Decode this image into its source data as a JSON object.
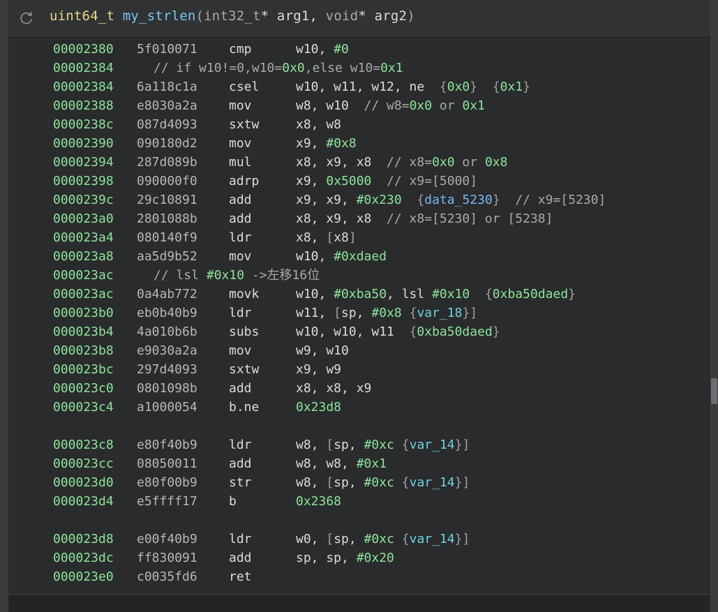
{
  "function_signature": {
    "return_type": "uint64_t",
    "name": "my_strlen",
    "open_paren": "(",
    "param1_type": "int32_t",
    "param1_rest": "* arg1, ",
    "param2_type": "void",
    "param2_rest": "* arg2",
    "close_paren": ")"
  },
  "lines": [
    {
      "kind": "insn",
      "addr": "00002380",
      "bytes": "5f010071",
      "mnemonic": "cmp",
      "ops": [
        [
          "p",
          "w10, "
        ],
        [
          "n",
          "#0"
        ]
      ]
    },
    {
      "kind": "comment",
      "addr": "00002384",
      "ops": [
        [
          "m",
          "// if w10!=0,w10="
        ],
        [
          "n",
          "0x0"
        ],
        [
          "m",
          ",else w10="
        ],
        [
          "n",
          "0x1"
        ]
      ]
    },
    {
      "kind": "insn",
      "addr": "00002384",
      "bytes": "6a118c1a",
      "mnemonic": "csel",
      "ops": [
        [
          "p",
          "w10, w11, w12, ne  "
        ],
        [
          "b",
          "{"
        ],
        [
          "n",
          "0x0"
        ],
        [
          "b",
          "}"
        ],
        [
          "p",
          "  "
        ],
        [
          "b",
          "{"
        ],
        [
          "n",
          "0x1"
        ],
        [
          "b",
          "}"
        ]
      ]
    },
    {
      "kind": "insn",
      "addr": "00002388",
      "bytes": "e8030a2a",
      "mnemonic": "mov",
      "ops": [
        [
          "p",
          "w8, w10  "
        ],
        [
          "m",
          "// w8="
        ],
        [
          "n",
          "0x0"
        ],
        [
          "m",
          " or "
        ],
        [
          "n",
          "0x1"
        ]
      ]
    },
    {
      "kind": "insn",
      "addr": "0000238c",
      "bytes": "087d4093",
      "mnemonic": "sxtw",
      "ops": [
        [
          "p",
          "x8, w8"
        ]
      ]
    },
    {
      "kind": "insn",
      "addr": "00002390",
      "bytes": "090180d2",
      "mnemonic": "mov",
      "ops": [
        [
          "p",
          "x9, "
        ],
        [
          "n",
          "#0x8"
        ]
      ]
    },
    {
      "kind": "insn",
      "addr": "00002394",
      "bytes": "287d089b",
      "mnemonic": "mul",
      "ops": [
        [
          "p",
          "x8, x9, x8  "
        ],
        [
          "m",
          "// x8="
        ],
        [
          "n",
          "0x0"
        ],
        [
          "m",
          " or "
        ],
        [
          "n",
          "0x8"
        ]
      ]
    },
    {
      "kind": "insn",
      "addr": "00002398",
      "bytes": "090000f0",
      "mnemonic": "adrp",
      "ops": [
        [
          "p",
          "x9, "
        ],
        [
          "n",
          "0x5000"
        ],
        [
          "m",
          "  // x9=[5000]"
        ]
      ]
    },
    {
      "kind": "insn",
      "addr": "0000239c",
      "bytes": "29c10891",
      "mnemonic": "add",
      "ops": [
        [
          "p",
          "x9, x9, "
        ],
        [
          "n",
          "#0x230"
        ],
        [
          "p",
          "  "
        ],
        [
          "b",
          "{"
        ],
        [
          "d",
          "data_5230"
        ],
        [
          "b",
          "}"
        ],
        [
          "m",
          "  // x9=[5230]"
        ]
      ]
    },
    {
      "kind": "insn",
      "addr": "000023a0",
      "bytes": "2801088b",
      "mnemonic": "add",
      "ops": [
        [
          "p",
          "x8, x9, x8  "
        ],
        [
          "m",
          "// x8=[5230] or [5238]"
        ]
      ]
    },
    {
      "kind": "insn",
      "addr": "000023a4",
      "bytes": "080140f9",
      "mnemonic": "ldr",
      "ops": [
        [
          "p",
          "x8, "
        ],
        [
          "b",
          "["
        ],
        [
          "p",
          "x8"
        ],
        [
          "b",
          "]"
        ]
      ]
    },
    {
      "kind": "insn",
      "addr": "000023a8",
      "bytes": "aa5d9b52",
      "mnemonic": "mov",
      "ops": [
        [
          "p",
          "w10, "
        ],
        [
          "n",
          "#0xdaed"
        ]
      ]
    },
    {
      "kind": "comment",
      "addr": "000023ac",
      "ops": [
        [
          "m",
          "// lsl "
        ],
        [
          "n",
          "#0x10"
        ],
        [
          "m",
          " ->左移16位"
        ]
      ]
    },
    {
      "kind": "insn",
      "addr": "000023ac",
      "bytes": "0a4ab772",
      "mnemonic": "movk",
      "ops": [
        [
          "p",
          "w10, "
        ],
        [
          "n",
          "#0xba50"
        ],
        [
          "p",
          ", lsl "
        ],
        [
          "n",
          "#0x10"
        ],
        [
          "p",
          "  "
        ],
        [
          "b",
          "{"
        ],
        [
          "n",
          "0xba50daed"
        ],
        [
          "b",
          "}"
        ]
      ]
    },
    {
      "kind": "insn",
      "addr": "000023b0",
      "bytes": "eb0b40b9",
      "mnemonic": "ldr",
      "ops": [
        [
          "p",
          "w11, "
        ],
        [
          "b",
          "["
        ],
        [
          "p",
          "sp, "
        ],
        [
          "n",
          "#0x8"
        ],
        [
          "p",
          " "
        ],
        [
          "b",
          "{"
        ],
        [
          "v",
          "var_18"
        ],
        [
          "b",
          "}"
        ],
        [
          "b",
          "]"
        ]
      ]
    },
    {
      "kind": "insn",
      "addr": "000023b4",
      "bytes": "4a010b6b",
      "mnemonic": "subs",
      "ops": [
        [
          "p",
          "w10, w10, w11  "
        ],
        [
          "b",
          "{"
        ],
        [
          "n",
          "0xba50daed"
        ],
        [
          "b",
          "}"
        ]
      ]
    },
    {
      "kind": "insn",
      "addr": "000023b8",
      "bytes": "e9030a2a",
      "mnemonic": "mov",
      "ops": [
        [
          "p",
          "w9, w10"
        ]
      ]
    },
    {
      "kind": "insn",
      "addr": "000023bc",
      "bytes": "297d4093",
      "mnemonic": "sxtw",
      "ops": [
        [
          "p",
          "x9, w9"
        ]
      ]
    },
    {
      "kind": "insn",
      "addr": "000023c0",
      "bytes": "0801098b",
      "mnemonic": "add",
      "ops": [
        [
          "p",
          "x8, x8, x9"
        ]
      ]
    },
    {
      "kind": "insn",
      "addr": "000023c4",
      "bytes": "a1000054",
      "mnemonic": "b.ne",
      "ops": [
        [
          "n",
          "0x23d8"
        ]
      ]
    },
    {
      "kind": "blank"
    },
    {
      "kind": "insn",
      "addr": "000023c8",
      "bytes": "e80f40b9",
      "mnemonic": "ldr",
      "ops": [
        [
          "p",
          "w8, "
        ],
        [
          "b",
          "["
        ],
        [
          "p",
          "sp, "
        ],
        [
          "n",
          "#0xc"
        ],
        [
          "p",
          " "
        ],
        [
          "b",
          "{"
        ],
        [
          "v",
          "var_14"
        ],
        [
          "b",
          "}"
        ],
        [
          "b",
          "]"
        ]
      ]
    },
    {
      "kind": "insn",
      "addr": "000023cc",
      "bytes": "08050011",
      "mnemonic": "add",
      "ops": [
        [
          "p",
          "w8, w8, "
        ],
        [
          "n",
          "#0x1"
        ]
      ]
    },
    {
      "kind": "insn",
      "addr": "000023d0",
      "bytes": "e80f00b9",
      "mnemonic": "str",
      "ops": [
        [
          "p",
          "w8, "
        ],
        [
          "b",
          "["
        ],
        [
          "p",
          "sp, "
        ],
        [
          "n",
          "#0xc"
        ],
        [
          "p",
          " "
        ],
        [
          "b",
          "{"
        ],
        [
          "v",
          "var_14"
        ],
        [
          "b",
          "}"
        ],
        [
          "b",
          "]"
        ]
      ]
    },
    {
      "kind": "insn",
      "addr": "000023d4",
      "bytes": "e5ffff17",
      "mnemonic": "b",
      "ops": [
        [
          "n",
          "0x2368"
        ]
      ]
    },
    {
      "kind": "blank"
    },
    {
      "kind": "insn",
      "addr": "000023d8",
      "bytes": "e00f40b9",
      "mnemonic": "ldr",
      "ops": [
        [
          "p",
          "w0, "
        ],
        [
          "b",
          "["
        ],
        [
          "p",
          "sp, "
        ],
        [
          "n",
          "#0xc"
        ],
        [
          "p",
          " "
        ],
        [
          "b",
          "{"
        ],
        [
          "v",
          "var_14"
        ],
        [
          "b",
          "}"
        ],
        [
          "b",
          "]"
        ]
      ]
    },
    {
      "kind": "insn",
      "addr": "000023dc",
      "bytes": "ff830091",
      "mnemonic": "add",
      "ops": [
        [
          "p",
          "sp, sp, "
        ],
        [
          "n",
          "#0x20"
        ]
      ]
    },
    {
      "kind": "insn",
      "addr": "000023e0",
      "bytes": "c0035fd6",
      "mnemonic": "ret",
      "ops": []
    }
  ],
  "icons": {
    "refresh": "refresh-icon"
  },
  "colors": {
    "address": "#8ee49a",
    "number": "#8ee49a",
    "variable": "#6fd1e0",
    "data_symbol": "#79b8f0",
    "return_type": "#e8d98a",
    "function_name": "#79c7f0"
  }
}
